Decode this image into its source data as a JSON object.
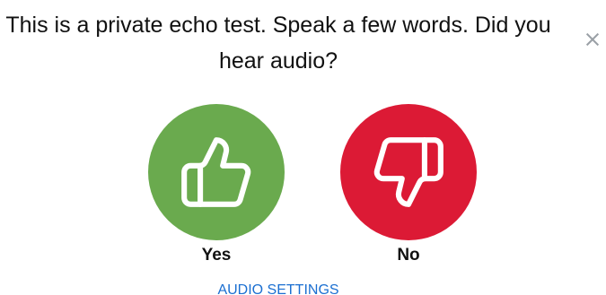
{
  "dialog": {
    "title": "This is a private echo test. Speak a few words. Did you hear audio?",
    "close_icon": "close-icon"
  },
  "choices": {
    "yes": {
      "label": "Yes",
      "icon": "thumbs-up-icon",
      "color": "#6aaa4e"
    },
    "no": {
      "label": "No",
      "icon": "thumbs-down-icon",
      "color": "#dc1a35"
    }
  },
  "footer": {
    "audio_settings_label": "AUDIO SETTINGS",
    "link_color": "#1b6fd1"
  }
}
